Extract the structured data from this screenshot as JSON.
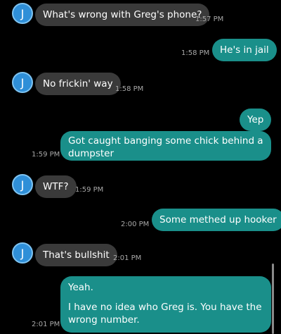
{
  "contact_initial": "J",
  "messages": [
    {
      "dir": "in",
      "text": "What's wrong with Greg's phone?",
      "time": "1:57 PM"
    },
    {
      "dir": "out",
      "text": "He's in jail",
      "time": "1:58 PM"
    },
    {
      "dir": "in",
      "text": "No frickin' way",
      "time": "1:58 PM"
    },
    {
      "dir": "out",
      "text": "Yep",
      "time": ""
    },
    {
      "dir": "out",
      "text": "Got caught banging some chick behind a dumpster",
      "time": "1:59 PM"
    },
    {
      "dir": "in",
      "text": "WTF?",
      "time": "1:59 PM"
    },
    {
      "dir": "out",
      "text": "Some methed up hooker",
      "time": "2:00 PM"
    },
    {
      "dir": "in",
      "text": "That's bullshit",
      "time": "2:01 PM"
    },
    {
      "dir": "out",
      "text_line1": "Yeah.",
      "text_line2": "I have no idea who Greg is. You have the wrong number.",
      "time": "2:01 PM"
    }
  ],
  "colors": {
    "incoming": "#3a3a3a",
    "outgoing": "#1a8f8a",
    "avatar": "#2f8fd8"
  }
}
